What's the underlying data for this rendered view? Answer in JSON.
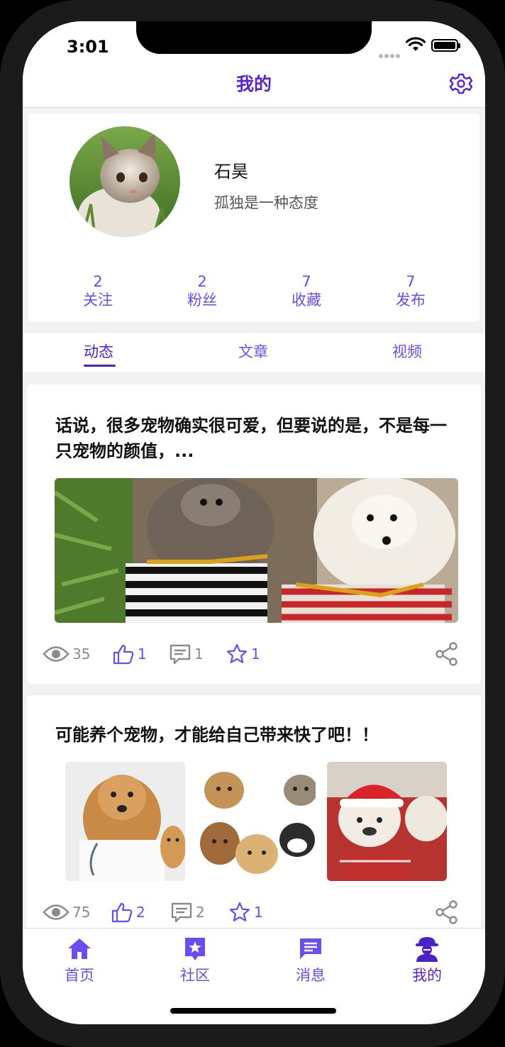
{
  "status_bar": {
    "time": "3:01"
  },
  "nav": {
    "title": "我的"
  },
  "profile": {
    "name": "石昊",
    "signature": "孤独是一种态度",
    "stats": [
      {
        "value": "2",
        "label": "关注"
      },
      {
        "value": "2",
        "label": "粉丝"
      },
      {
        "value": "7",
        "label": "收藏"
      },
      {
        "value": "7",
        "label": "发布"
      }
    ]
  },
  "tabs": [
    {
      "label": "动态",
      "active": true
    },
    {
      "label": "文章",
      "active": false
    },
    {
      "label": "视频",
      "active": false
    }
  ],
  "posts": [
    {
      "text": "话说，很多宠物确实很可爱，但要说的是，不是每一只宠物的颜值，...",
      "views": "35",
      "likes": "1",
      "comments": "1",
      "favorites": "1"
    },
    {
      "text": "可能养个宠物，才能给自己带来快了吧！！",
      "views": "75",
      "likes": "2",
      "comments": "2",
      "favorites": "1"
    }
  ],
  "tabbar": [
    {
      "label": "首页",
      "icon": "home-icon"
    },
    {
      "label": "社区",
      "icon": "community-icon"
    },
    {
      "label": "消息",
      "icon": "message-icon"
    },
    {
      "label": "我的",
      "icon": "profile-icon",
      "active": true
    }
  ],
  "colors": {
    "accent": "#6a4cf0",
    "accent_dark": "#5a22d2",
    "gray_icon": "#8a8a8a"
  }
}
